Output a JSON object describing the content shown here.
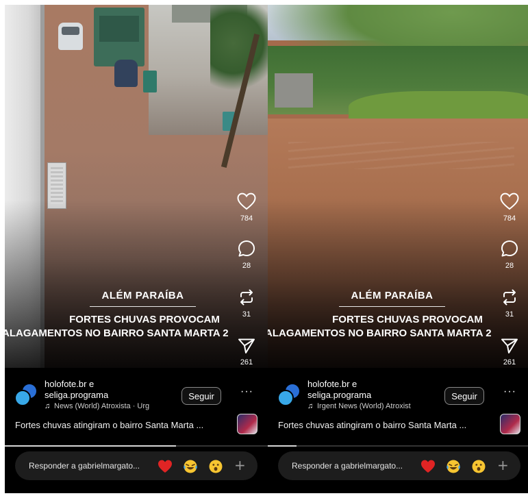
{
  "panels": [
    {
      "location": "ALÉM PARAÍBA",
      "headline_line1": "FORTES CHUVAS PROVOCAM",
      "headline_line2": "ALAGAMENTOS NO BAIRRO SANTA MARTA 2",
      "likes": "784",
      "comments": "28",
      "reposts": "31",
      "shares": "261",
      "author_line1": "holofote.br e",
      "author_line2": "seliga.programa",
      "music": "News (World)   Atroxista · Urg",
      "follow_label": "Seguir",
      "more_label": "···",
      "caption": "Fortes chuvas atingiram o bairro Santa Marta ...",
      "progress": 0.65,
      "reply_placeholder": "Responder a gabrielmargato...",
      "plus_label": "+"
    },
    {
      "location": "ALÉM PARAÍBA",
      "headline_line1": "FORTES CHUVAS PROVOCAM",
      "headline_line2": "ALAGAMENTOS NO BAIRRO SANTA MARTA 2",
      "likes": "784",
      "comments": "28",
      "reposts": "31",
      "shares": "261",
      "author_line1": "holofote.br e",
      "author_line2": "seliga.programa",
      "music": "Irgent News (World)   Atroxist",
      "follow_label": "Seguir",
      "more_label": "···",
      "caption": "Fortes chuvas atingiram o bairro Santa Marta ...",
      "progress": 0.11,
      "reply_placeholder": "Responder a gabrielmargato...",
      "plus_label": "+"
    }
  ],
  "icons": {
    "like": "heart-outline-icon",
    "comment": "speech-bubble-icon",
    "repost": "repost-arrows-icon",
    "share": "paper-plane-icon",
    "music": "music-note-icon",
    "emoji_1": "red-heart-emoji",
    "emoji_2": "tears-of-joy-emoji",
    "emoji_3": "astonished-face-emoji",
    "add": "plus-icon"
  },
  "colors": {
    "background": "#000000",
    "text": "#ffffff",
    "reply_bar": "#1d1d1d",
    "heart_emoji": "#e02424",
    "avatar_blue": "#2a6fd6"
  }
}
